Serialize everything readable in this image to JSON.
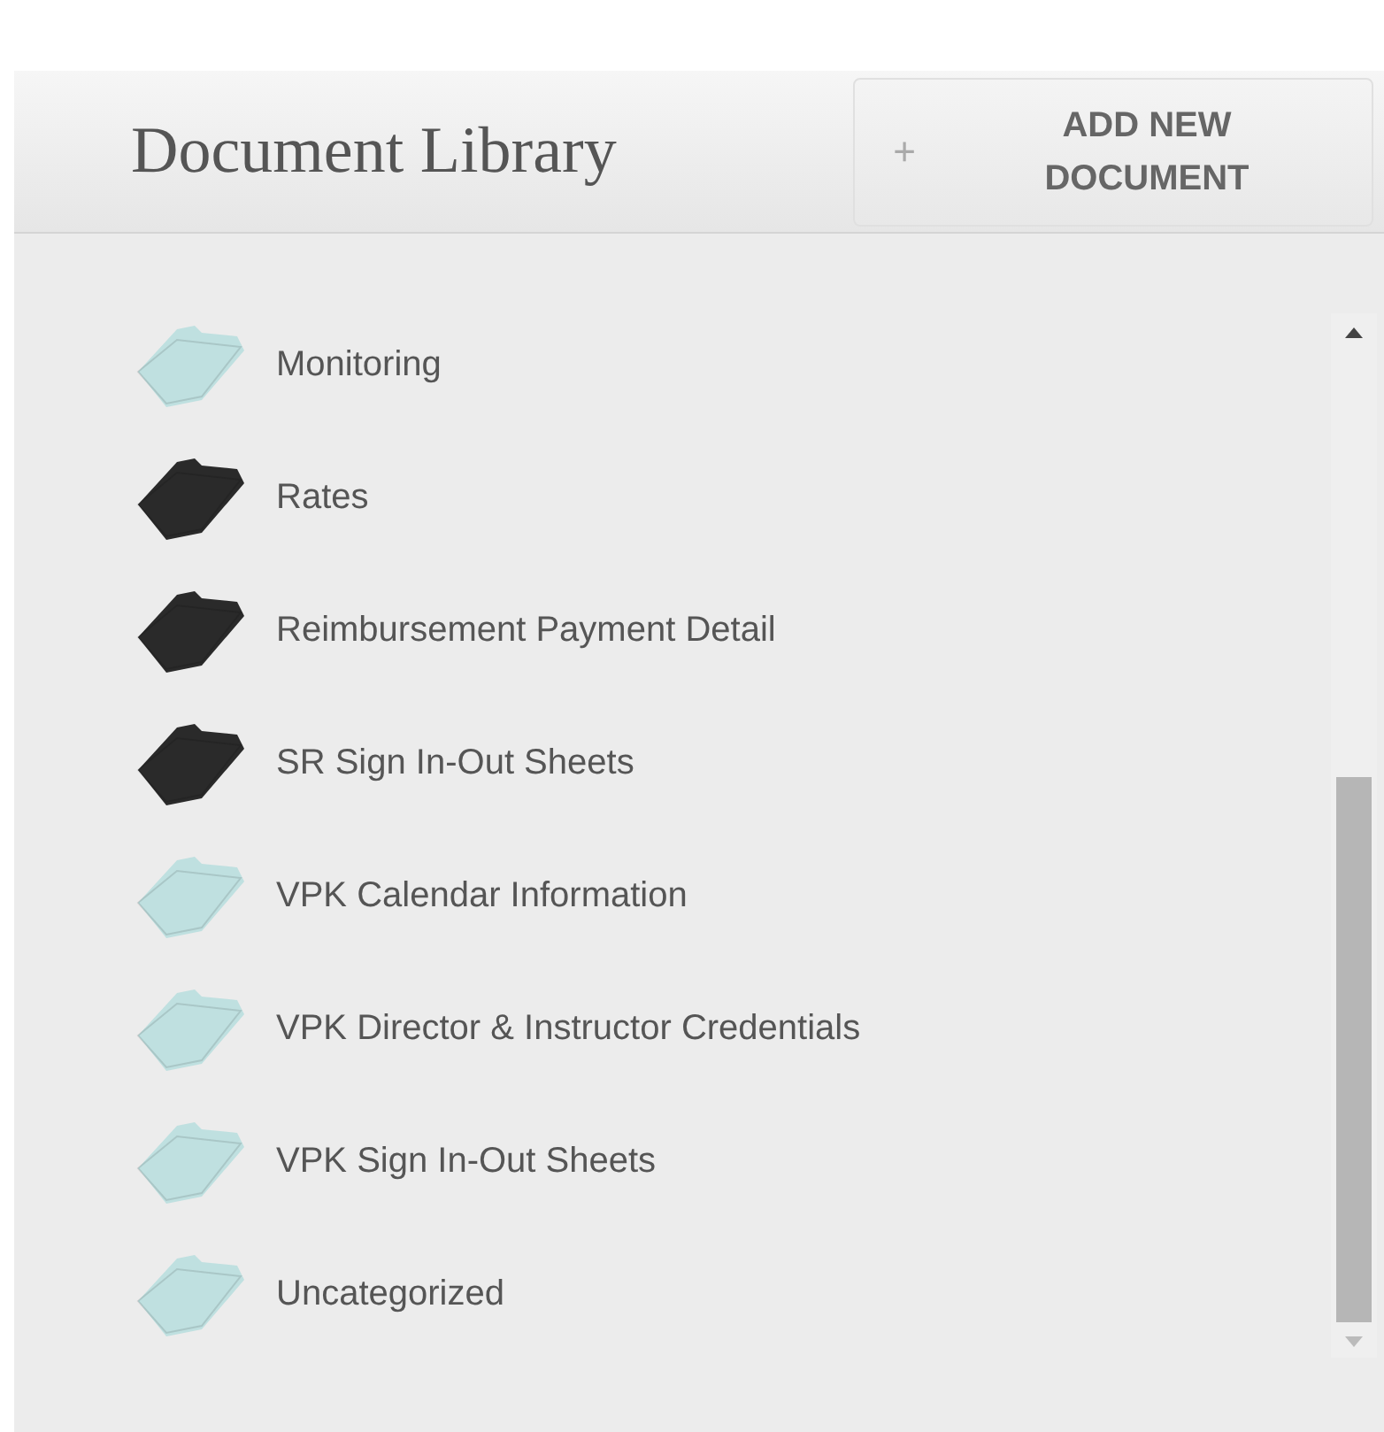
{
  "header": {
    "title": "Document Library",
    "add_button": {
      "icon": "+",
      "label": "ADD NEW DOCUMENT"
    }
  },
  "folders": [
    {
      "name": "Monitoring",
      "color": "#bfe0e0"
    },
    {
      "name": "Rates",
      "color": "#2a2a2a"
    },
    {
      "name": "Reimbursement Payment Detail",
      "color": "#2a2a2a"
    },
    {
      "name": "SR Sign In-Out Sheets",
      "color": "#2a2a2a"
    },
    {
      "name": "VPK Calendar Information",
      "color": "#bfe0e0"
    },
    {
      "name": "VPK Director & Instructor Credentials",
      "color": "#bfe0e0"
    },
    {
      "name": "VPK Sign In-Out Sheets",
      "color": "#bfe0e0"
    },
    {
      "name": "Uncategorized",
      "color": "#bfe0e0"
    }
  ]
}
